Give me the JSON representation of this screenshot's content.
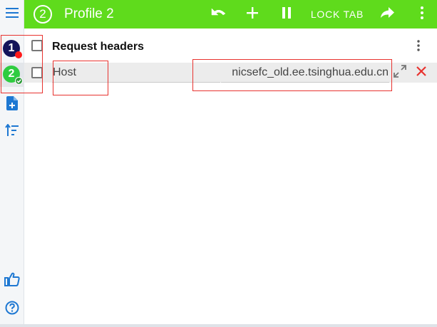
{
  "topbar": {
    "profile_number": "2",
    "title": "Profile 2",
    "lock_tab_label": "LOCK TAB",
    "accent_color": "#5fdb1c",
    "icons": [
      "undo-icon",
      "plus-icon",
      "pause-icon",
      "share-icon",
      "more-vert-icon"
    ]
  },
  "rail": {
    "profiles": [
      {
        "number": "1",
        "color": "#14145a",
        "status": "red-dot"
      },
      {
        "number": "2",
        "color": "#2ecc40",
        "status": "check",
        "selected": true
      }
    ],
    "icons": [
      "menu-icon",
      "add-file-icon",
      "sort-icon",
      "thumbs-up-icon",
      "help-icon"
    ]
  },
  "section": {
    "title": "Request headers"
  },
  "headers": [
    {
      "name": "Host",
      "value": "nicsefc_old.ee.tsinghua.edu.cn",
      "enabled": false
    }
  ],
  "colors": {
    "annotation": "#e8332f",
    "delete": "#e8332f"
  }
}
